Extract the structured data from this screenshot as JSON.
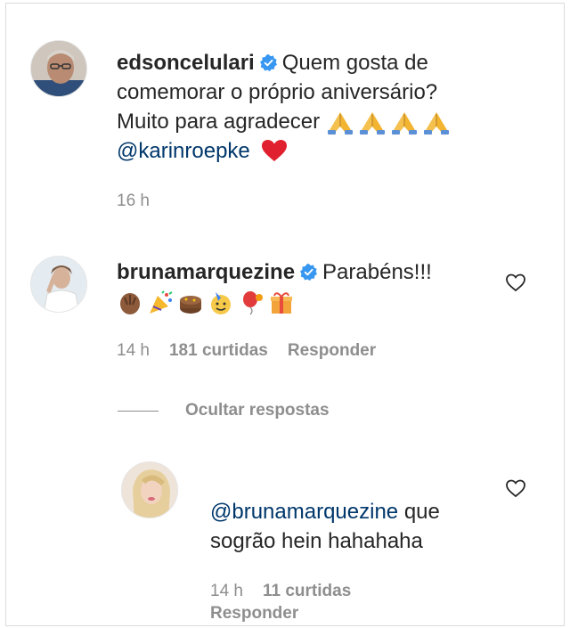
{
  "post_comment": {
    "username": "edsoncelulari",
    "text_line1": "Quem gosta de",
    "text_line2": "comemorar o próprio aniversário?",
    "text_line3": "Muito para agradecer",
    "mention": "@karinroepke",
    "time": "16 h",
    "avatar_icon": "man-avatar",
    "extra_icons": [
      "praying-hands-icon",
      "praying-hands-icon",
      "praying-hands-icon",
      "praying-hands-icon",
      "red-heart-icon"
    ]
  },
  "comment_1": {
    "username": "brunamarquezine",
    "text": "Parabéns!!!",
    "emojis": [
      "clapping-hands-icon",
      "party-popper-icon",
      "cake-icon",
      "party-face-icon",
      "balloon-icon",
      "gift-icon"
    ],
    "time": "14 h",
    "likes": "181 curtidas",
    "reply_label": "Responder"
  },
  "hide_replies_label": "Ocultar respostas",
  "reply_1": {
    "mention": "@brunamarquezine",
    "text_part1": "que",
    "text_line2": "sogrão hein hahahaha",
    "time": "14 h",
    "likes": "11 curtidas",
    "reply_label": "Responder"
  },
  "colors": {
    "verified_blue": "#3897f0",
    "mention_blue": "#00376b",
    "meta_gray": "#8e8e8e",
    "heart_red": "#ed4956"
  }
}
